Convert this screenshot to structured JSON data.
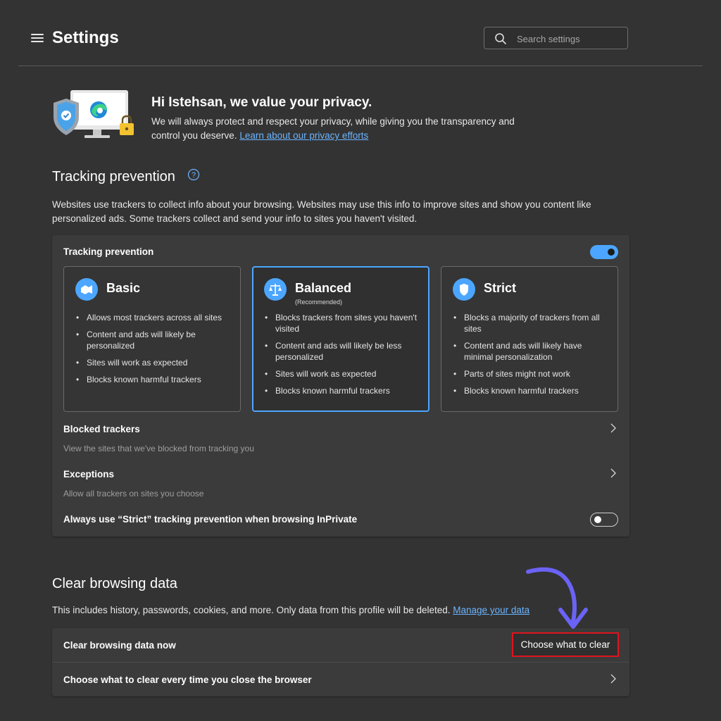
{
  "header": {
    "title": "Settings",
    "search_placeholder": "Search settings"
  },
  "privacy": {
    "heading": "Hi Istehsan, we value your privacy.",
    "text": "We will always protect and respect your privacy, while giving you the transparency and control you deserve.",
    "link": "Learn about our privacy efforts"
  },
  "tracking": {
    "section_title": "Tracking prevention",
    "description": "Websites use trackers to collect info about your browsing. Websites may use this info to improve sites and show you content like personalized ads. Some trackers collect and send your info to sites you haven't visited.",
    "card_label": "Tracking prevention",
    "enabled": true,
    "levels": [
      {
        "name": "Basic",
        "subtitle": "",
        "icon": "basic-level-icon",
        "selected": false,
        "bullets": [
          "Allows most trackers across all sites",
          "Content and ads will likely be personalized",
          "Sites will work as expected",
          "Blocks known harmful trackers"
        ]
      },
      {
        "name": "Balanced",
        "subtitle": "(Recommended)",
        "icon": "scales-icon",
        "selected": true,
        "bullets": [
          "Blocks trackers from sites you haven't visited",
          "Content and ads will likely be less personalized",
          "Sites will work as expected",
          "Blocks known harmful trackers"
        ]
      },
      {
        "name": "Strict",
        "subtitle": "",
        "icon": "shield-icon",
        "selected": false,
        "bullets": [
          "Blocks a majority of trackers from all sites",
          "Content and ads will likely have minimal personalization",
          "Parts of sites might not work",
          "Blocks known harmful trackers"
        ]
      }
    ],
    "blocked": {
      "title": "Blocked trackers",
      "subtitle": "View the sites that we've blocked from tracking you"
    },
    "exceptions": {
      "title": "Exceptions",
      "subtitle": "Allow all trackers on sites you choose"
    },
    "inprivate": {
      "label": "Always use “Strict” tracking prevention when browsing InPrivate",
      "enabled": false
    }
  },
  "clear_data": {
    "section_title": "Clear browsing data",
    "description": "This includes history, passwords, cookies, and more. Only data from this profile will be deleted.",
    "link": "Manage your data",
    "now_label": "Clear browsing data now",
    "button_label": "Choose what to clear",
    "on_close_label": "Choose what to clear every time you close the browser"
  },
  "colors": {
    "background": "#333333",
    "card": "#3b3b3b",
    "accent": "#4ca6ff",
    "link": "#6cb4ff",
    "highlight_box": "#e0141e",
    "annotation_arrow": "#6b63f5"
  }
}
